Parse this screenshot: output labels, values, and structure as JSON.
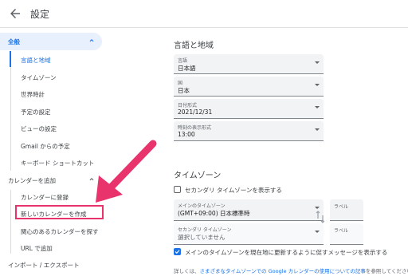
{
  "header": {
    "title": "設定"
  },
  "sidebar": {
    "general": {
      "label": "全般",
      "items": [
        "言語と地域",
        "タイムゾーン",
        "世界時計",
        "予定の設定",
        "ビューの設定",
        "Gmail からの予定",
        "キーボード ショートカット"
      ]
    },
    "add_calendar": {
      "label": "カレンダーを追加",
      "items": [
        "カレンダーに登録",
        "新しいカレンダーを作成",
        "関心のあるカレンダーを探す",
        "URL で追加"
      ]
    },
    "import_export": "インポート / エクスポート"
  },
  "language_region": {
    "title": "言語と地域",
    "fields": [
      {
        "caption": "言語",
        "value": "日本語"
      },
      {
        "caption": "国",
        "value": "日本"
      },
      {
        "caption": "日付形式",
        "value": "2021/12/31"
      },
      {
        "caption": "時刻の表示形式",
        "value": "13:00"
      }
    ]
  },
  "timezone": {
    "title": "タイムゾーン",
    "secondary_checkbox": "セカンダリ タイムゾーンを表示する",
    "primary": {
      "caption": "メインのタイムゾーン",
      "value": "(GMT+09:00) 日本標準時",
      "label_caption": "ラベル"
    },
    "secondary": {
      "caption": "セカンダリ タイムゾーン",
      "value": "選択していません",
      "label_caption": "ラベル"
    },
    "update_checkbox": "メインのタイムゾーンを現在地に更新するように促すメッセージを表示する",
    "footnote_prefix": "詳しくは、",
    "footnote_link": "さまざまなタイムゾーンでの Google カレンダーの使用についての記事",
    "footnote_suffix": "を参照してください"
  },
  "colors": {
    "accent": "#1a73e8",
    "highlight": "#e8336d"
  }
}
